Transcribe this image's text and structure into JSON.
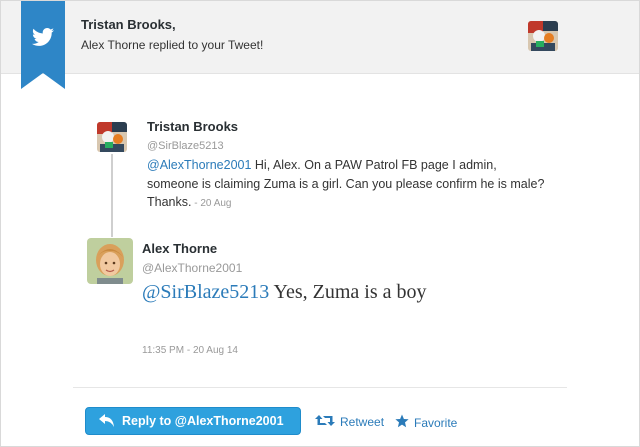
{
  "header": {
    "recipient_name": "Tristan Brooks,",
    "subtitle": "Alex Thorne replied to your Tweet!"
  },
  "original_tweet": {
    "name": "Tristan Brooks",
    "handle": "@SirBlaze5213",
    "mention": "@AlexThorne2001",
    "text": " Hi, Alex. On a PAW Patrol FB page I admin, someone is claiming Zuma is a girl. Can you please confirm he is male? Thanks.",
    "date": " - 20 Aug"
  },
  "reply_tweet": {
    "name": "Alex Thorne",
    "handle": "@AlexThorne2001",
    "mention": "@SirBlaze5213",
    "text": " Yes, Zuma is a boy",
    "timestamp": "11:35 PM - 20 Aug 14"
  },
  "actions": {
    "reply_label": "Reply to @AlexThorne2001",
    "retweet_label": "Retweet",
    "favorite_label": "Favorite"
  },
  "colors": {
    "accent": "#2ea1de",
    "link": "#2b7bb9",
    "ribbon": "#2e86c7"
  },
  "icons": {
    "logo": "twitter-bird-icon",
    "reply": "reply-arrow-icon",
    "retweet": "retweet-icon",
    "favorite": "star-icon"
  }
}
